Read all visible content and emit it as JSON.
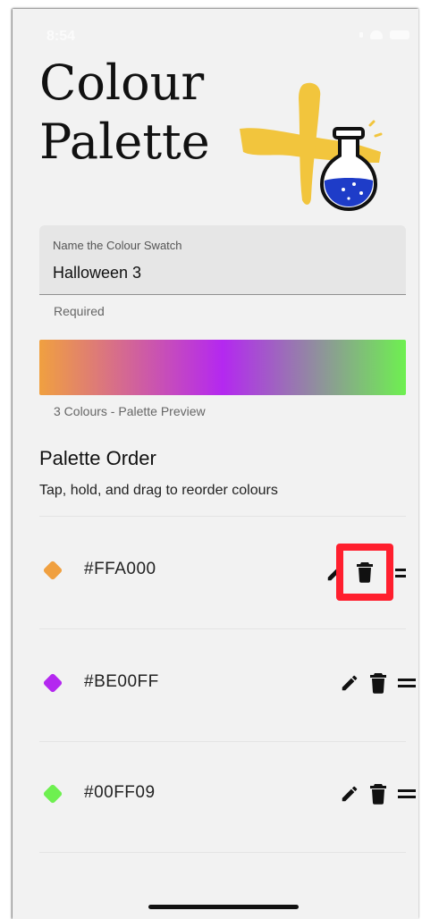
{
  "status_bar": {
    "time": "8:54"
  },
  "header": {
    "title_line1": "Colour",
    "title_line2": "Palette"
  },
  "name_field": {
    "label": "Name the Colour Swatch",
    "value": "Halloween 3",
    "helper": "Required"
  },
  "preview": {
    "caption": "3 Colours - Palette Preview",
    "gradient_colors": [
      "#F0A040",
      "#B428F0",
      "#6EF050"
    ]
  },
  "palette_order": {
    "title": "Palette Order",
    "subtitle": "Tap, hold, and drag to reorder colours"
  },
  "colours": [
    {
      "hex": "#FFA000",
      "swatch": "#F0A040"
    },
    {
      "hex": "#BE00FF",
      "swatch": "#B428F0"
    },
    {
      "hex": "#00FF09",
      "swatch": "#6EF050"
    }
  ],
  "icons": {
    "edit": "pencil-icon",
    "delete": "trash-icon",
    "reorder": "drag-handle-icon"
  },
  "colors": {
    "background": "#F2F2F2",
    "highlight": "#FF1F2E",
    "logo_yellow": "#F2C53D",
    "flask_blue": "#1E3CC8"
  }
}
